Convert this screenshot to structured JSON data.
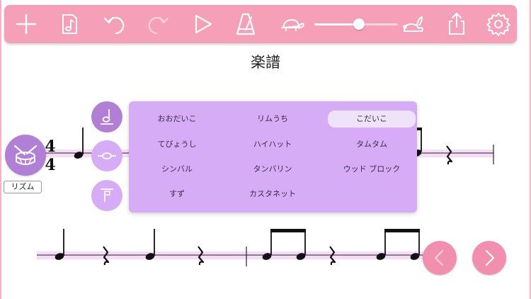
{
  "toolbar": {
    "buttons": [
      {
        "name": "add-icon",
        "enabled": true
      },
      {
        "name": "note-file-icon",
        "enabled": true
      },
      {
        "name": "undo-icon",
        "enabled": true
      },
      {
        "name": "redo-icon",
        "enabled": false
      },
      {
        "name": "play-icon",
        "enabled": true
      },
      {
        "name": "metronome-icon",
        "enabled": true
      },
      {
        "name": "turtle-icon",
        "enabled": true
      },
      {
        "name": "rabbit-icon",
        "enabled": true
      },
      {
        "name": "share-icon",
        "enabled": true
      },
      {
        "name": "settings-gear-icon",
        "enabled": true
      }
    ],
    "tempo_slider": {
      "level": 0.48
    }
  },
  "score": {
    "title": "楽譜",
    "time_signature": {
      "top": "4",
      "bottom": "4"
    }
  },
  "rhythm_button": {
    "label": "リズム",
    "icon": "drum-icon"
  },
  "side_buttons": [
    {
      "name": "half-note-icon",
      "active": true
    },
    {
      "name": "whole-note-icon",
      "active": false
    },
    {
      "name": "rest-icon",
      "active": false
    }
  ],
  "instrument_menu": {
    "selected": "こだいこ",
    "rows": [
      [
        "おおだいこ",
        "リムうち",
        "こだいこ"
      ],
      [
        "てびょうし",
        "ハイハット",
        "タムタム"
      ],
      [
        "シンバル",
        "タンバリン",
        "ウッド ブロック"
      ],
      [
        "すず",
        "カスタネット",
        ""
      ]
    ]
  },
  "nav": {
    "prev": "chevron-left-icon",
    "next": "chevron-right-icon"
  },
  "colors": {
    "toolbar": "#f5a0b8",
    "accent_purple": "#b27fd6",
    "popup": "#d6acf6",
    "staff_highlight": "#f6dcf6",
    "nav": "#f28fae"
  }
}
